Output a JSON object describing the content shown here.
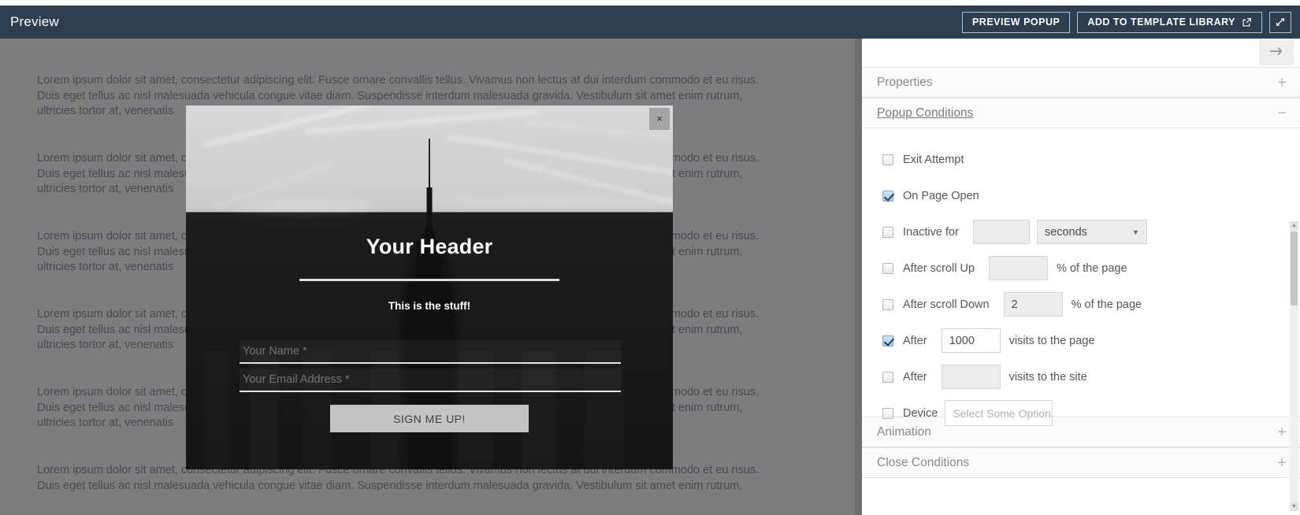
{
  "topbar": {
    "title": "Preview",
    "preview_popup_label": "PREVIEW POPUP",
    "add_to_library_label": "ADD TO TEMPLATE LIBRARY",
    "external_link_icon": "external-link-icon",
    "expand_icon": "expand-diagonal-icon",
    "background_color": "#2c3e50"
  },
  "preview": {
    "background_color": "#7d7d7d",
    "paragraph": "Lorem ipsum dolor sit amet, consectetur adipiscing elit. Fusce ornare convallis tellus. Vivamus non lectus at dui interdum commodo et eu risus.\nDuis eget tellus ac nisl malesuada vehicula congue vitae diam. Suspendisse interdum malesuada gravida. Vestibulum sit amet enim rutrum,\nultricies tortor at, venenatis",
    "paragraph_full": "Lorem ipsum dolor sit amet, consectetur adipiscing elit. Fusce ornare convallis tellus. Vivamus non lectus at dui interdum commodo et eu risus.\nDuis eget tellus ac nisl malesuada vehicula congue vitae diam. Suspendisse interdum malesuada gravida. Vestibulum sit amet enim rutrum,"
  },
  "popup": {
    "close_label": "×",
    "header": "Your Header",
    "subtext": "This is the stuff!",
    "name_placeholder": "Your Name *",
    "email_placeholder": "Your Email Address *",
    "name_value": "",
    "email_value": "",
    "submit_label": "SIGN ME UP!",
    "submit_color": "#c3c3c3"
  },
  "panel": {
    "collapse_arrow_icon": "arrow-right-icon",
    "sections": [
      {
        "label": "Properties",
        "sign": "+",
        "expanded": false
      },
      {
        "label": "Popup Conditions",
        "sign": "−",
        "expanded": true
      },
      {
        "label": "Animation",
        "sign": "+",
        "expanded": false
      },
      {
        "label": "Close Conditions",
        "sign": "+",
        "expanded": false
      }
    ],
    "conditions": [
      {
        "label": "Exit Attempt",
        "checked": false
      },
      {
        "label": "On Page Open",
        "checked": true
      },
      {
        "label": "Inactive for",
        "checked": false,
        "value": "",
        "unit": "seconds"
      },
      {
        "label": "After scroll Up",
        "checked": false,
        "value": "",
        "suffix": "% of the page"
      },
      {
        "label": "After scroll Down",
        "checked": false,
        "value": "2",
        "suffix": "% of the page"
      },
      {
        "label": "After",
        "checked": true,
        "value": "1000",
        "suffix": "visits to the page"
      },
      {
        "label": "After",
        "checked": false,
        "value": "",
        "suffix": "visits to the site"
      },
      {
        "label": "Device",
        "checked": false,
        "placeholder": "Select Some Options"
      }
    ],
    "scrollbar": {
      "up": "▲",
      "down": "▼"
    }
  }
}
